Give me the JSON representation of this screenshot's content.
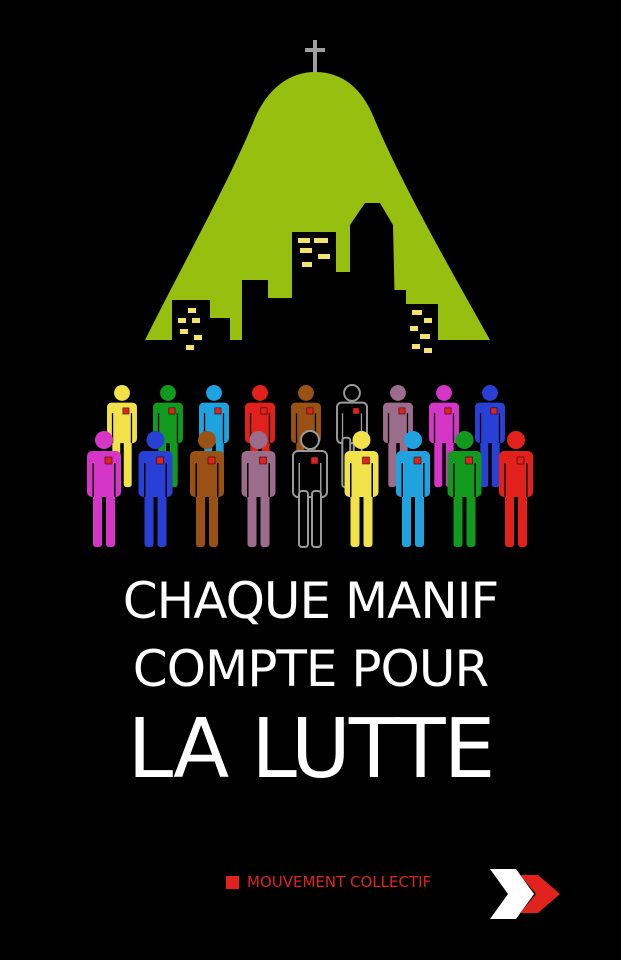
{
  "headline": {
    "line1": "CHAQUE MANIF",
    "line2": "COMPTE POUR",
    "line3": "LA LUTTE"
  },
  "footer": {
    "label": "MOUVEMENT COLLECTIF"
  },
  "colors": {
    "background": "#000000",
    "mountain": "#97bf10",
    "building": "#000000",
    "window": "#f2e36c",
    "accent": "#e0231c",
    "text": "#ffffff"
  },
  "icons": [
    "cross-icon",
    "person-icon",
    "logo-chevron-icon"
  ],
  "crowd": {
    "back_row_colors": [
      "#f2e24a",
      "#119a1e",
      "#1fa3df",
      "#e2211c",
      "#9a5214",
      "#000000",
      "#9b6d8a",
      "#d636c8",
      "#2840d6"
    ],
    "front_row_colors": [
      "#d636c8",
      "#2840d6",
      "#9a5214",
      "#9b6d8a",
      "#000000",
      "#f2e24a",
      "#1fa3df",
      "#119a1e",
      "#e2211c"
    ]
  }
}
